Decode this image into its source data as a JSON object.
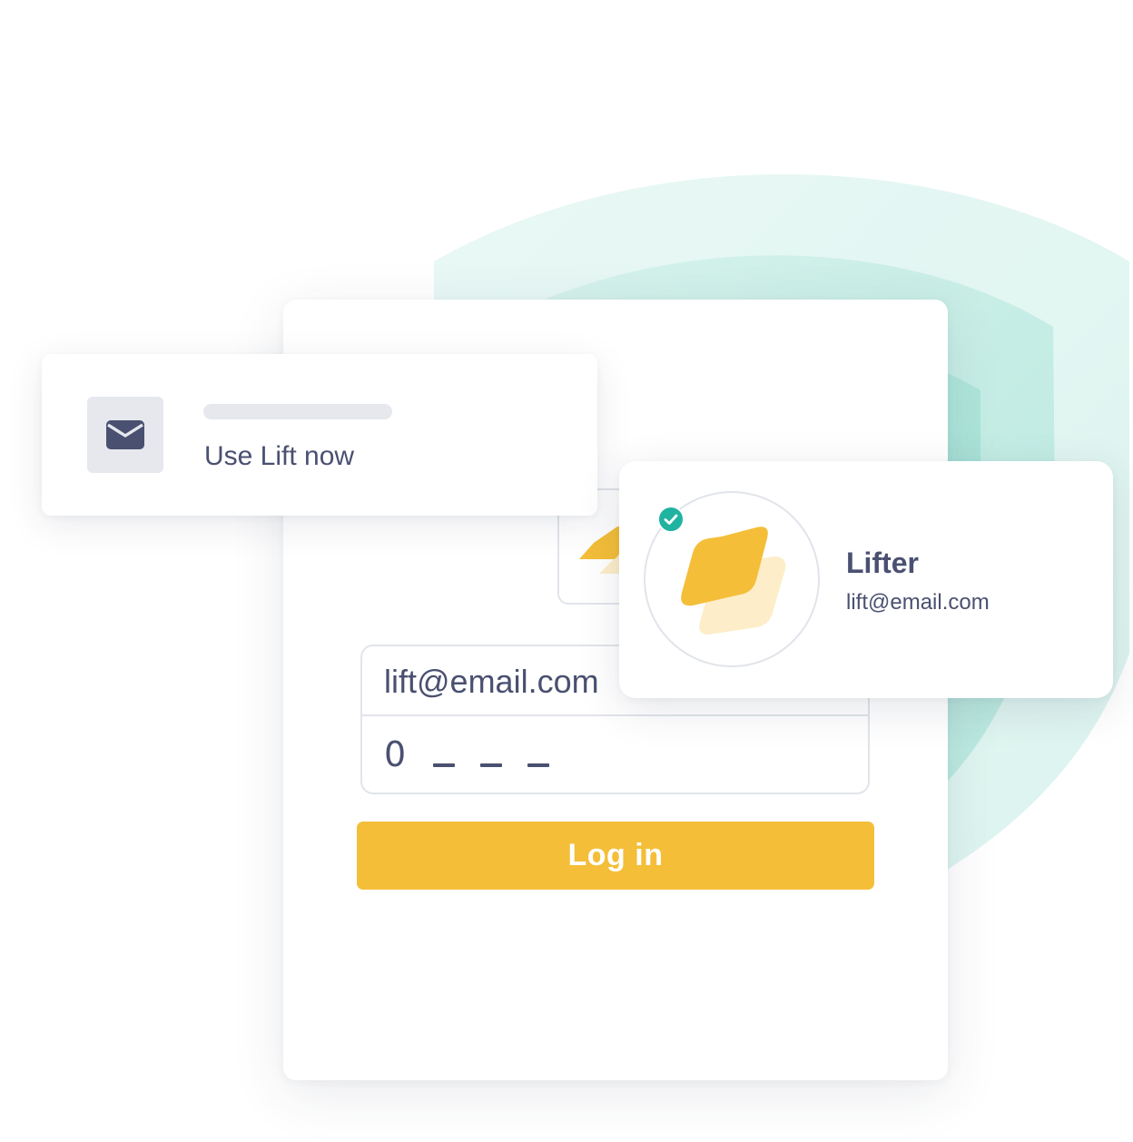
{
  "colors": {
    "accent": "#f4be39",
    "accent_light": "#fdeec9",
    "text": "#4a5070",
    "border": "#e1e4ea",
    "placeholder": "#e6e8ee",
    "shield": "#9fe0d4",
    "verified": "#20b3a0"
  },
  "login": {
    "email_value": "lift@email.com",
    "code": {
      "first_digit": "0"
    },
    "button_label": "Log in",
    "logo_icon": "lift-logo-icon"
  },
  "notification": {
    "icon": "envelope-icon",
    "text": "Use Lift now"
  },
  "profile": {
    "name": "Lifter",
    "email": "lift@email.com",
    "avatar_icon": "lift-logo-icon",
    "badge_icon": "check-circle-icon"
  }
}
